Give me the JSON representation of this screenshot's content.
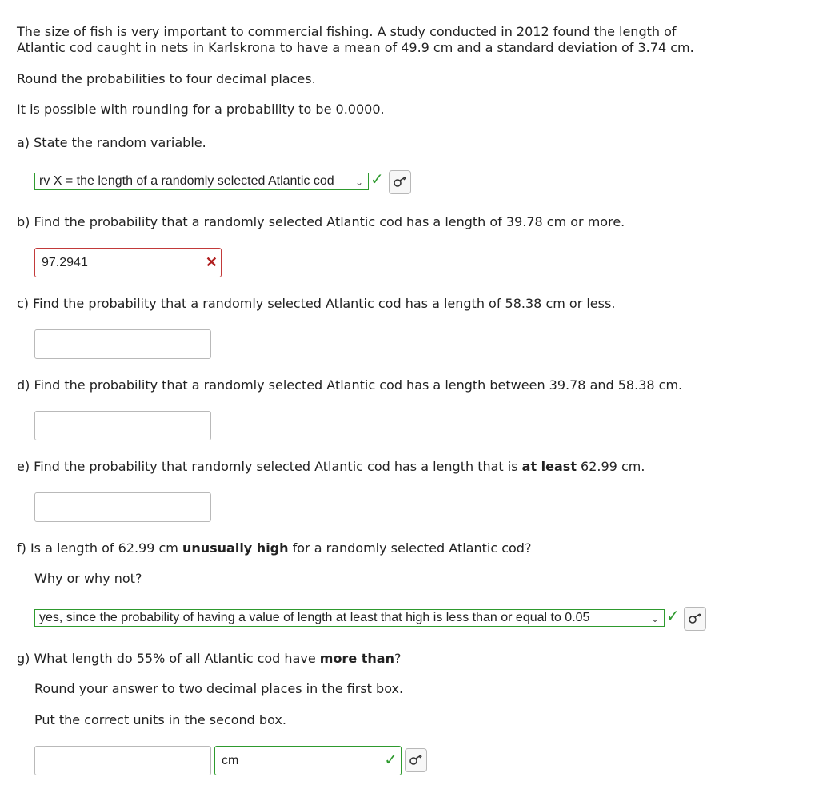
{
  "intro": {
    "line1": "The size of fish is very important to commercial fishing. A study conducted in 2012 found the length of",
    "line2": "Atlantic cod caught in nets in Karlskrona to have a mean of 49.9 cm and a standard deviation of 3.74 cm."
  },
  "rounding_note": "Round the probabilities to four decimal places.",
  "zero_note": "It is possible with rounding for a probability to be 0.0000.",
  "part_a": {
    "question": "a) State the random variable.",
    "selected": "rv X = the length of a randomly selected Atlantic cod"
  },
  "part_b": {
    "question": "b) Find the probability that a randomly selected Atlantic cod has a length of 39.78 cm or more.",
    "answer": "97.2941"
  },
  "part_c": {
    "question": "c) Find the probability that a randomly selected Atlantic cod has a length of 58.38 cm or less.",
    "answer": ""
  },
  "part_d": {
    "question": "d) Find the probability that a randomly selected Atlantic cod has a length between 39.78 and 58.38 cm.",
    "answer": ""
  },
  "part_e": {
    "q_pre": "e) Find the probability that randomly selected Atlantic cod has a length that is ",
    "q_bold": "at least",
    "q_post": " 62.99 cm.",
    "answer": ""
  },
  "part_f": {
    "q_pre": "f) Is a length of 62.99 cm ",
    "q_bold": "unusually high",
    "q_post": " for a randomly selected Atlantic cod?",
    "why": "Why or why not?",
    "selected": "yes, since the probability of having a value of length at least that high is less than or equal to 0.05"
  },
  "part_g": {
    "q_pre": "g) What length do 55% of all Atlantic cod have ",
    "q_bold": "more than",
    "q_post": "?",
    "round_note": "Round your answer to two decimal places in the first box.",
    "units_note": "Put the correct units in the second box.",
    "answer": "",
    "units": "cm"
  },
  "colors": {
    "correct": "#2e9a2e",
    "incorrect": "#c23a3a"
  },
  "icons": {
    "check": "check-icon",
    "cross": "cross-icon",
    "key": "key-icon",
    "dropdown": "chevron-down-icon"
  }
}
